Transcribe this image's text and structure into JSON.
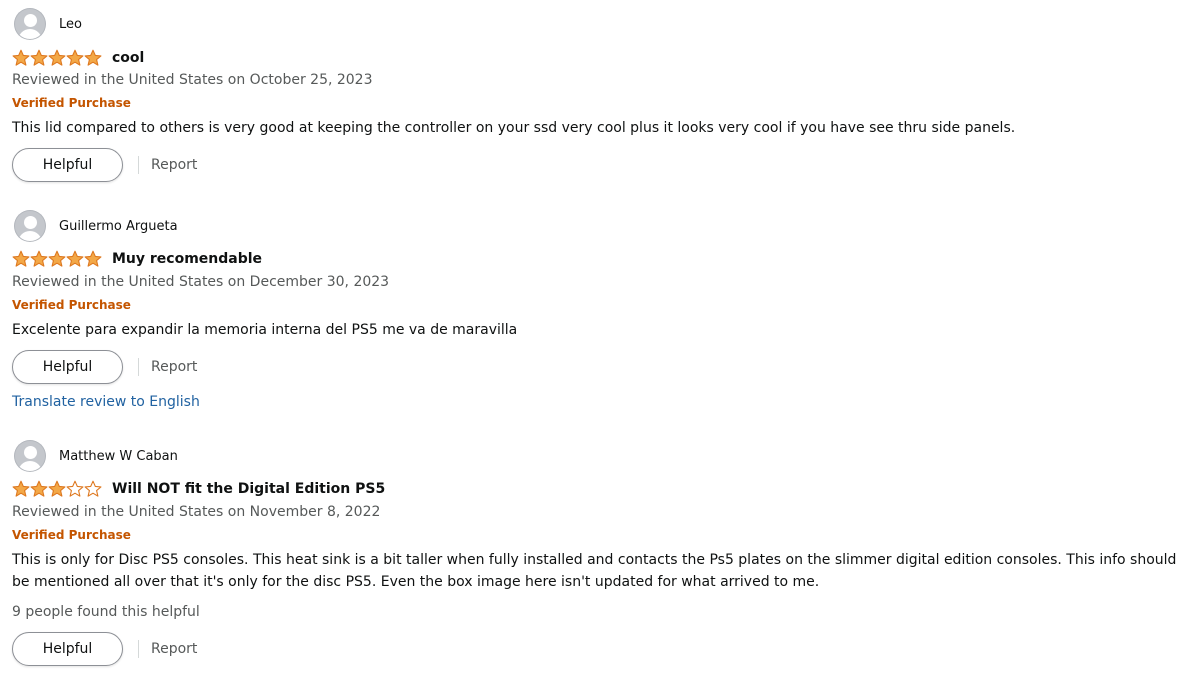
{
  "colors": {
    "star_fill": "#f3a847",
    "star_stroke": "#de7921",
    "verified": "#c45500",
    "link": "#2162a1",
    "meta": "#565959"
  },
  "icons": {
    "avatar": "default-user-avatar-icon",
    "star_filled": "star-filled-icon",
    "star_empty": "star-empty-icon"
  },
  "reviews": [
    {
      "reviewer": "Leo",
      "rating": 5,
      "title": "cool",
      "meta": "Reviewed in the United States on October 25, 2023",
      "verified": "Verified Purchase",
      "body": "This lid compared to others is very good at keeping the controller on your ssd very cool plus it looks very cool if you have see thru side panels.",
      "helpful_label": "Helpful",
      "report_label": "Report"
    },
    {
      "reviewer": "Guillermo Argueta",
      "rating": 5,
      "title": "Muy recomendable",
      "meta": "Reviewed in the United States on December 30, 2023",
      "verified": "Verified Purchase",
      "body": "Excelente para expandir la memoria interna del PS5 me va de maravilla",
      "helpful_label": "Helpful",
      "report_label": "Report",
      "translate_label": "Translate review to English"
    },
    {
      "reviewer": "Matthew W Caban",
      "rating": 3,
      "title": "Will NOT fit the Digital Edition PS5",
      "meta": "Reviewed in the United States on November 8, 2022",
      "verified": "Verified Purchase",
      "body": "This is only for Disc PS5 consoles. This heat sink is a bit taller when fully installed and contacts the Ps5 plates on the slimmer digital edition consoles. This info should be mentioned all over that it's only for the disc PS5. Even the box image here isn't updated for what arrived to me.",
      "found_helpful": "9 people found this helpful",
      "helpful_label": "Helpful",
      "report_label": "Report"
    }
  ]
}
